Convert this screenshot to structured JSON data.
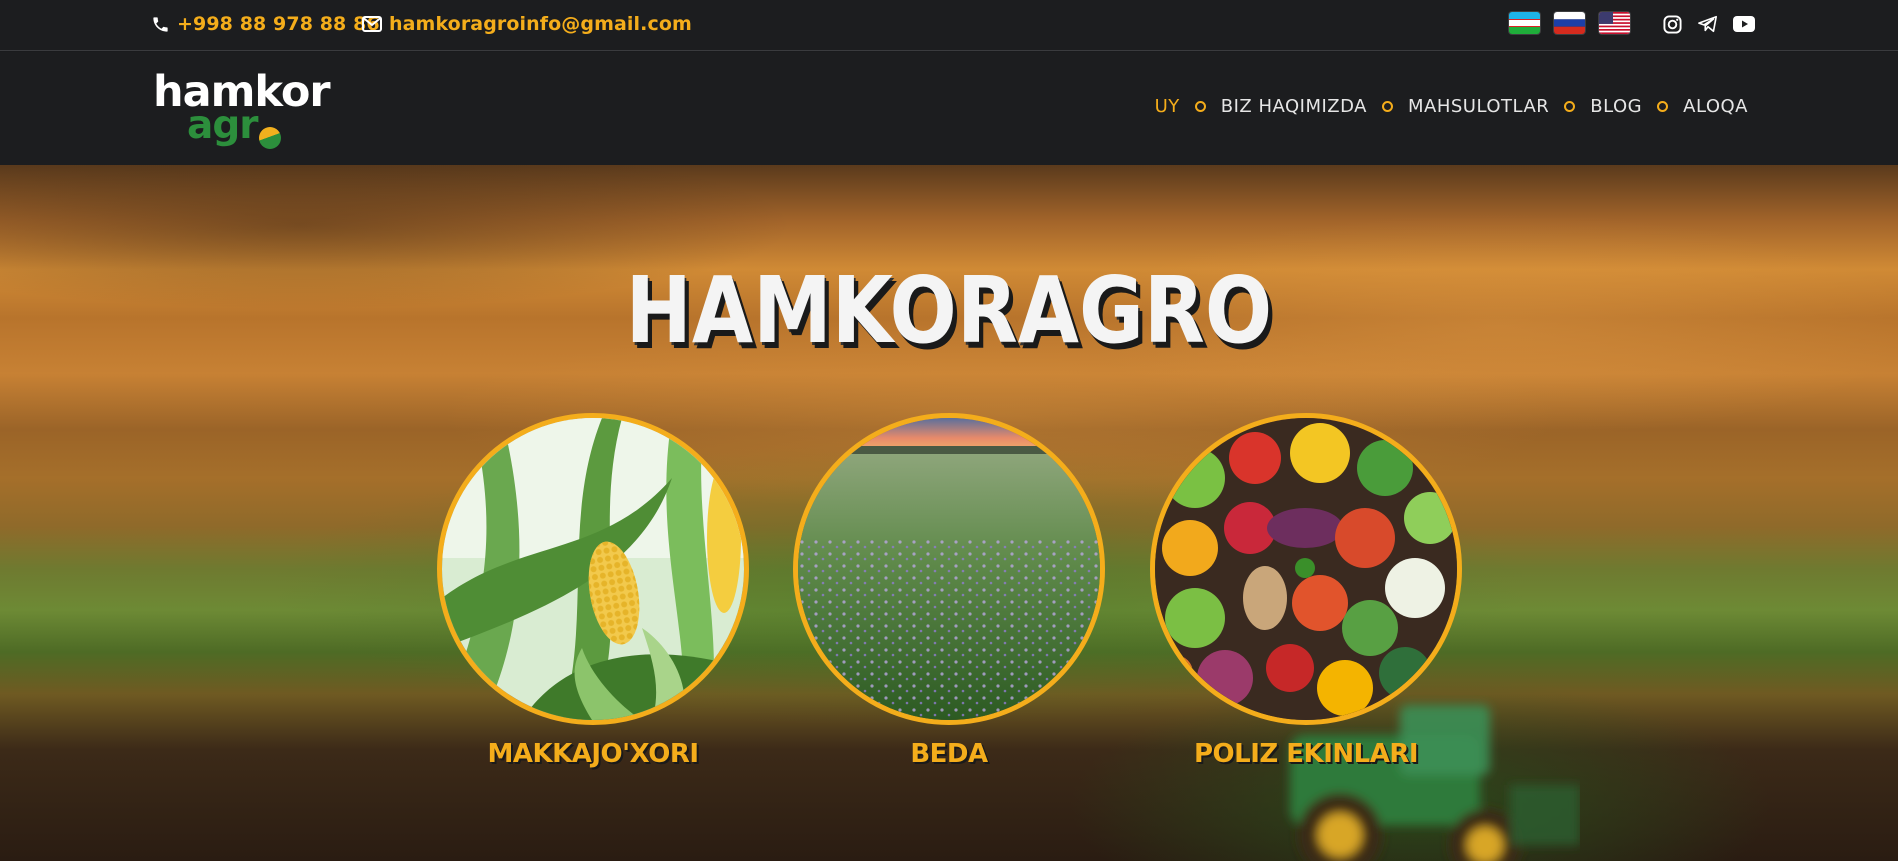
{
  "topbar": {
    "phone": "+998 88 978 88 86",
    "email": "hamkoragroinfo@gmail.com",
    "languages": [
      "uz",
      "ru",
      "en"
    ],
    "socials": [
      "instagram-icon",
      "telegram-icon",
      "youtube-icon"
    ]
  },
  "header": {
    "logo_line1": "hamkor",
    "logo_line2": "agr",
    "nav": {
      "home": "UY",
      "about": "BIZ HAQIMIZDA",
      "products": "MAHSULOTLAR",
      "blog": "BLOG",
      "contact": "ALOQA"
    }
  },
  "hero": {
    "title": "HAMKORAGRO",
    "products": [
      {
        "label": "MAKKAJO'XORI"
      },
      {
        "label": "BEDA"
      },
      {
        "label": "POLIZ EKINLARI"
      }
    ]
  },
  "colors": {
    "accent": "#f4ad1b",
    "brand_green": "#2c8f3c",
    "bar_bg": "#1c1d1f"
  }
}
